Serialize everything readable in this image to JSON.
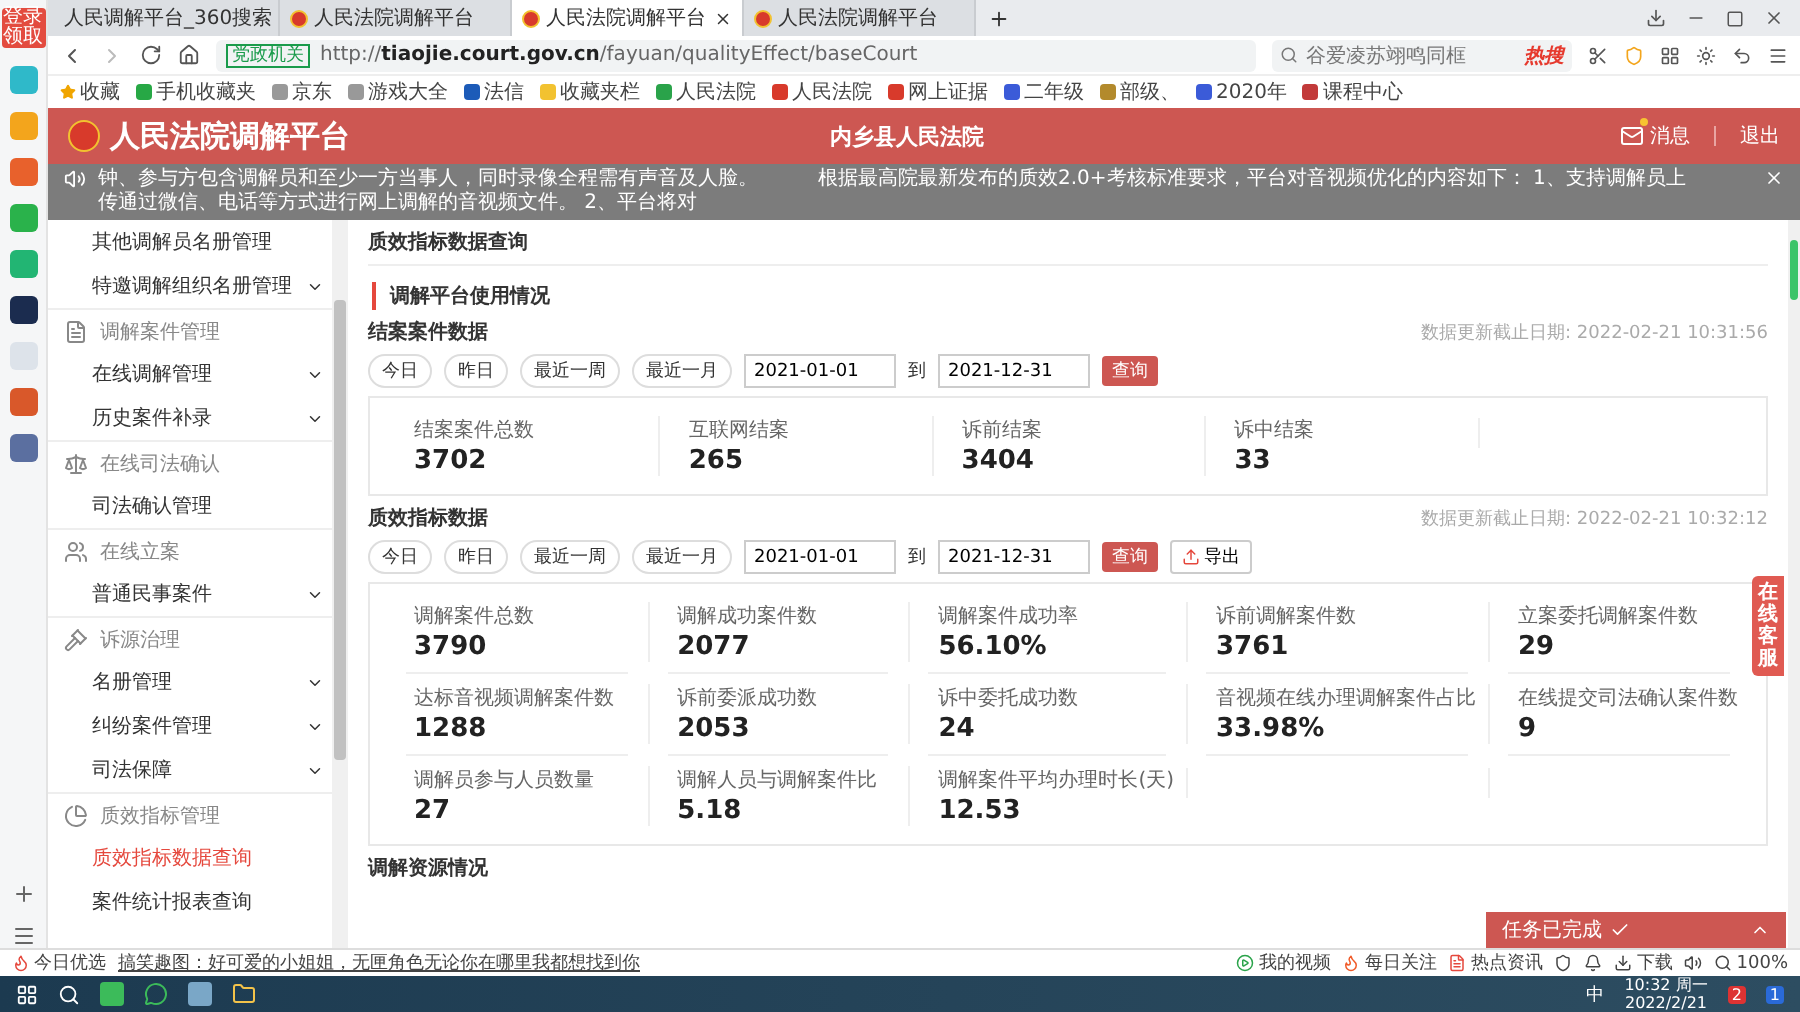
{
  "side_panel": {
    "badge": "登录领取"
  },
  "browser": {
    "tabs": [
      {
        "label": "人民调解平台_360搜索",
        "selected": false
      },
      {
        "label": "人民法院调解平台",
        "selected": false
      },
      {
        "label": "人民法院调解平台",
        "selected": true
      },
      {
        "label": "人民法院调解平台",
        "selected": false
      }
    ],
    "address": {
      "badge": "党政机关",
      "url": "http://**tiaojie.court.gov.cn**/fayuan/qualityEffect/baseCourt"
    },
    "search": {
      "placeholder": "谷爱凌苏翊鸣同框",
      "badge": "热搜"
    },
    "bookmarks": [
      "收藏",
      "手机收藏夹",
      "京东",
      "游戏大全",
      "法信",
      "收藏夹栏",
      "人民法院",
      "人民法院",
      "网上证据",
      "二年级",
      "部级、",
      "2020年",
      "课程中心"
    ]
  },
  "header": {
    "title": "人民法院调解平台",
    "court": "内乡县人民法院",
    "messages": "消息",
    "unread": true,
    "logout": "退出"
  },
  "notice": [
    "钟、参与方包含调解员和至少一方当事人，同时录像全程需有声音及人脸。",
    "根据最高院最新发布的质效2.0+考核标准要求，平台对音视频优化的内容如下： 1、支持调解员上传通过微信、电话等方式进行网上调解的音视频文件。 2、平台将对"
  ],
  "nav": [
    {
      "kind": "item",
      "label": "其他调解员名册管理",
      "expandable": false,
      "selected": false
    },
    {
      "kind": "item",
      "label": "特邀调解组织名册管理",
      "expandable": true,
      "selected": false
    },
    {
      "kind": "group",
      "label": "调解案件管理"
    },
    {
      "kind": "item",
      "label": "在线调解管理",
      "expandable": true,
      "selected": false
    },
    {
      "kind": "item",
      "label": "历史案件补录",
      "expandable": true,
      "selected": false
    },
    {
      "kind": "group",
      "label": "在线司法确认"
    },
    {
      "kind": "item",
      "label": "司法确认管理",
      "expandable": false,
      "selected": false
    },
    {
      "kind": "group",
      "label": "在线立案"
    },
    {
      "kind": "item",
      "label": "普通民事案件",
      "expandable": true,
      "selected": false
    },
    {
      "kind": "group",
      "label": "诉源治理"
    },
    {
      "kind": "item",
      "label": "名册管理",
      "expandable": true,
      "selected": false
    },
    {
      "kind": "item",
      "label": "纠纷案件管理",
      "expandable": true,
      "selected": false
    },
    {
      "kind": "item",
      "label": "司法保障",
      "expandable": true,
      "selected": false
    },
    {
      "kind": "group",
      "label": "质效指标管理"
    },
    {
      "kind": "item",
      "label": "质效指标数据查询",
      "expandable": false,
      "selected": true
    },
    {
      "kind": "item",
      "label": "案件统计报表查询",
      "expandable": false,
      "selected": false
    }
  ],
  "page_tab": "质效指标数据查询",
  "section_title": "调解平台使用情况",
  "panels": [
    {
      "title": "结案案件数据",
      "updated": "数据更新截止日期: 2022-02-21 10:31:56",
      "ranges": [
        "今日",
        "昨日",
        "最近一周",
        "最近一月"
      ],
      "start": "2021-01-01",
      "to": "到",
      "end": "2021-12-31",
      "query": "查询",
      "stats": [
        {
          "label": "结案案件总数",
          "value": "3702"
        },
        {
          "label": "互联网结案",
          "value": "265"
        },
        {
          "label": "诉前结案",
          "value": "3404"
        },
        {
          "label": "诉中结案",
          "value": "33"
        }
      ]
    },
    {
      "title": "质效指标数据",
      "updated": "数据更新截止日期: 2022-02-21 10:32:12",
      "ranges": [
        "今日",
        "昨日",
        "最近一周",
        "最近一月"
      ],
      "start": "2021-01-01",
      "to": "到",
      "end": "2021-12-31",
      "query": "查询",
      "export": "导出",
      "stats": [
        {
          "label": "调解案件总数",
          "value": "3790"
        },
        {
          "label": "调解成功案件数",
          "value": "2077"
        },
        {
          "label": "调解案件成功率",
          "value": "56.10%"
        },
        {
          "label": "诉前调解案件数",
          "value": "3761"
        },
        {
          "label": "立案委托调解案件数",
          "value": "29"
        },
        {
          "label": "达标音视频调解案件数",
          "value": "1288"
        },
        {
          "label": "诉前委派成功数",
          "value": "2053"
        },
        {
          "label": "诉中委托成功数",
          "value": "24"
        },
        {
          "label": "音视频在线办理调解案件占比",
          "value": "33.98%"
        },
        {
          "label": "在线提交司法确认案件数",
          "value": "9"
        },
        {
          "label": "调解员参与人员数量",
          "value": "27"
        },
        {
          "label": "调解人员与调解案件比",
          "value": "5.18"
        },
        {
          "label": "调解案件平均办理时长(天)",
          "value": "12.53"
        }
      ]
    }
  ],
  "next_section": "调解资源情况",
  "chat_tab": "在线客服",
  "task": {
    "label": "任务已完成",
    "done": true
  },
  "status_bar": {
    "promo": "今日优选",
    "news": "搞笑趣图：好可爱的小姐姐，无匣角色无论你在哪里我都想找到你",
    "links": [
      "我的视频",
      "每日关注",
      "热点资讯"
    ],
    "download": "下载",
    "zoom": "100%"
  },
  "taskbar": {
    "ime": "中",
    "time": "10:32 周一",
    "date": "2022/2/21",
    "badges": [
      "2",
      "1"
    ]
  }
}
